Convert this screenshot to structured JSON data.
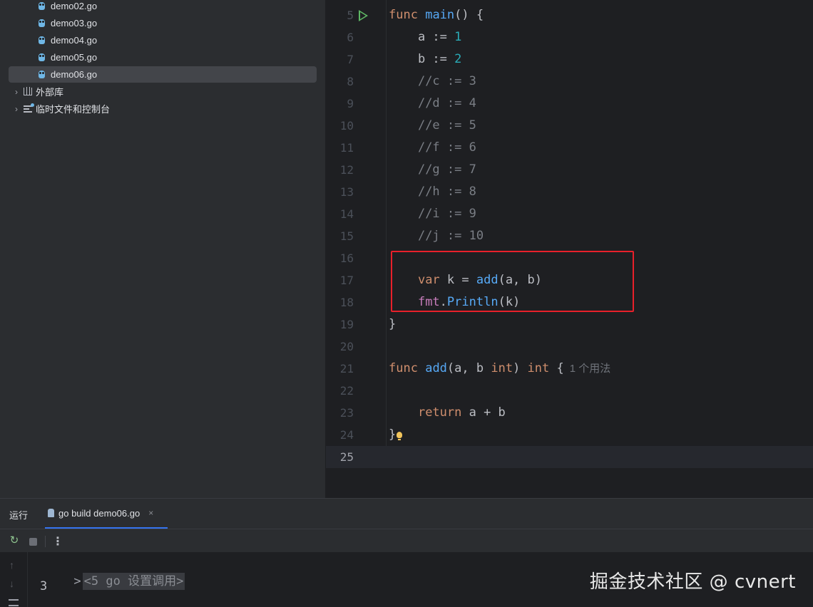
{
  "project_tree": {
    "files": [
      {
        "label": "demo02.go",
        "selected": false
      },
      {
        "label": "demo03.go",
        "selected": false
      },
      {
        "label": "demo04.go",
        "selected": false
      },
      {
        "label": "demo05.go",
        "selected": false
      },
      {
        "label": "demo06.go",
        "selected": true
      }
    ],
    "external_libraries": "外部库",
    "scratches": "临时文件和控制台"
  },
  "editor": {
    "lines": [
      {
        "no": "5",
        "code": "func main() {"
      },
      {
        "no": "6",
        "code": "a := 1"
      },
      {
        "no": "7",
        "code": "b := 2"
      },
      {
        "no": "8",
        "code": "//c := 3"
      },
      {
        "no": "9",
        "code": "//d := 4"
      },
      {
        "no": "10",
        "code": "//e := 5"
      },
      {
        "no": "11",
        "code": "//f := 6"
      },
      {
        "no": "12",
        "code": "//g := 7"
      },
      {
        "no": "13",
        "code": "//h := 8"
      },
      {
        "no": "14",
        "code": "//i := 9"
      },
      {
        "no": "15",
        "code": "//j := 10"
      },
      {
        "no": "16",
        "code": ""
      },
      {
        "no": "17",
        "code": "var k = add(a, b)"
      },
      {
        "no": "18",
        "code": "fmt.Println(k)"
      },
      {
        "no": "19",
        "code": "}"
      },
      {
        "no": "20",
        "code": ""
      },
      {
        "no": "21",
        "code": "func add(a, b int) int {"
      },
      {
        "no": "22",
        "code": ""
      },
      {
        "no": "23",
        "code": "return a + b"
      },
      {
        "no": "24",
        "code": "}"
      },
      {
        "no": "25",
        "code": ""
      }
    ],
    "usage_hint": "1 个用法",
    "current_line": "25"
  },
  "run_panel": {
    "title": "运行",
    "tab_label": "go build demo06.go",
    "close_glyph": "×",
    "more_glyph": "⋮",
    "rerun_glyph": "↻",
    "up_glyph": "↑",
    "down_glyph": "↓",
    "console": {
      "fold_chevron": ">",
      "fold_text": "<5 go 设置调用>",
      "output": "3"
    }
  },
  "watermark": "掘金技术社区 @ cvnert",
  "colors": {
    "keyword": "#cf8e6d",
    "function": "#56a8f5",
    "number": "#2aacb8",
    "comment": "#7a7e85",
    "highlight_box": "#e8202a",
    "accent": "#3574f0"
  }
}
